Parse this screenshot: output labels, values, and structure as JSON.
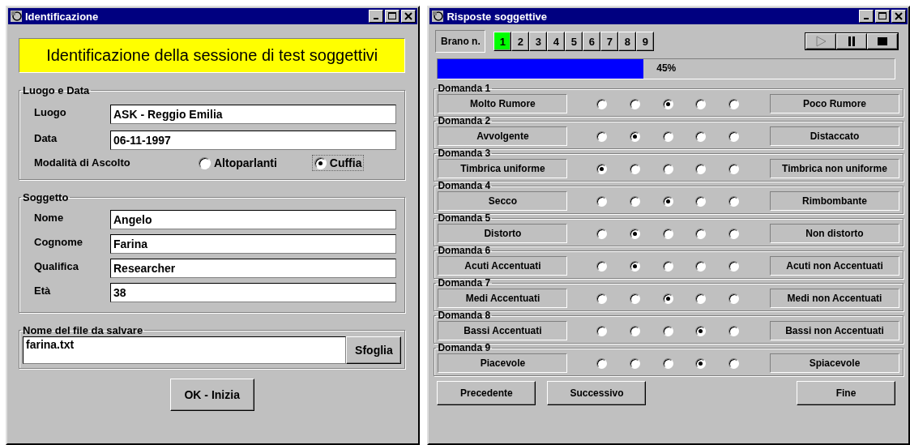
{
  "left_window": {
    "title": "Identificazione",
    "banner": "Identificazione della sessione di test soggettivi",
    "luogo_e_data": {
      "legend": "Luogo e Data",
      "fields": [
        {
          "label": "Luogo",
          "value": "ASK - Reggio Emilia"
        },
        {
          "label": "Data",
          "value": "06-11-1997"
        }
      ],
      "mode_label": "Modalità di Ascolto",
      "modes": [
        {
          "label": "Altoparlanti",
          "selected": false
        },
        {
          "label": "Cuffia",
          "selected": true
        }
      ]
    },
    "soggetto": {
      "legend": "Soggetto",
      "fields": [
        {
          "label": "Nome",
          "value": "Angelo"
        },
        {
          "label": "Cognome",
          "value": "Farina"
        },
        {
          "label": "Qualifica",
          "value": "Researcher"
        },
        {
          "label": "Età",
          "value": "38"
        }
      ]
    },
    "file": {
      "legend": "Nome del file da salvare",
      "value": "farina.txt",
      "browse": "Sfoglia"
    },
    "ok_button": "OK - Inizia"
  },
  "right_window": {
    "title": "Risposte soggettive",
    "brano_label": "Brano n.",
    "brani": [
      {
        "label": "1",
        "selected": true
      },
      {
        "label": "2",
        "selected": false
      },
      {
        "label": "3",
        "selected": false
      },
      {
        "label": "4",
        "selected": false
      },
      {
        "label": "5",
        "selected": false
      },
      {
        "label": "6",
        "selected": false
      },
      {
        "label": "7",
        "selected": false
      },
      {
        "label": "8",
        "selected": false
      },
      {
        "label": "9",
        "selected": false
      }
    ],
    "media": [
      {
        "kind": "play",
        "disabled": true
      },
      {
        "kind": "pause",
        "disabled": false
      },
      {
        "kind": "stop",
        "disabled": false
      }
    ],
    "progress": {
      "level": 0.45,
      "reading": "45%"
    },
    "questions": [
      {
        "title": "Domanda 1",
        "left": "Molto Rumore",
        "right": "Poco Rumore",
        "options": [
          {
            "selected": false
          },
          {
            "selected": false
          },
          {
            "selected": true
          },
          {
            "selected": false
          },
          {
            "selected": false
          }
        ]
      },
      {
        "title": "Domanda 2",
        "left": "Avvolgente",
        "right": "Distaccato",
        "options": [
          {
            "selected": false
          },
          {
            "selected": true
          },
          {
            "selected": false
          },
          {
            "selected": false
          },
          {
            "selected": false
          }
        ]
      },
      {
        "title": "Domanda 3",
        "left": "Timbrica uniforme",
        "right": "Timbrica non uniforme",
        "options": [
          {
            "selected": true
          },
          {
            "selected": false
          },
          {
            "selected": false
          },
          {
            "selected": false
          },
          {
            "selected": false
          }
        ]
      },
      {
        "title": "Domanda 4",
        "left": "Secco",
        "right": "Rimbombante",
        "options": [
          {
            "selected": false
          },
          {
            "selected": false
          },
          {
            "selected": true
          },
          {
            "selected": false
          },
          {
            "selected": false
          }
        ]
      },
      {
        "title": "Domanda 5",
        "left": "Distorto",
        "right": "Non distorto",
        "options": [
          {
            "selected": false
          },
          {
            "selected": true
          },
          {
            "selected": false
          },
          {
            "selected": false
          },
          {
            "selected": false
          }
        ]
      },
      {
        "title": "Domanda 6",
        "left": "Acuti Accentuati",
        "right": "Acuti non Accentuati",
        "options": [
          {
            "selected": false
          },
          {
            "selected": true
          },
          {
            "selected": false
          },
          {
            "selected": false
          },
          {
            "selected": false
          }
        ]
      },
      {
        "title": "Domanda 7",
        "left": "Medi Accentuati",
        "right": "Medi non Accentuati",
        "options": [
          {
            "selected": false
          },
          {
            "selected": false
          },
          {
            "selected": true
          },
          {
            "selected": false
          },
          {
            "selected": false
          }
        ]
      },
      {
        "title": "Domanda 8",
        "left": "Bassi Accentuati",
        "right": "Bassi non Accentuati",
        "options": [
          {
            "selected": false
          },
          {
            "selected": false
          },
          {
            "selected": false
          },
          {
            "selected": true
          },
          {
            "selected": false
          }
        ]
      },
      {
        "title": "Domanda 9",
        "left": "Piacevole",
        "right": "Spiacevole",
        "options": [
          {
            "selected": false
          },
          {
            "selected": false
          },
          {
            "selected": false
          },
          {
            "selected": true
          },
          {
            "selected": false
          }
        ]
      }
    ],
    "buttons": [
      "Precedente",
      "Successivo",
      "Fine"
    ]
  }
}
